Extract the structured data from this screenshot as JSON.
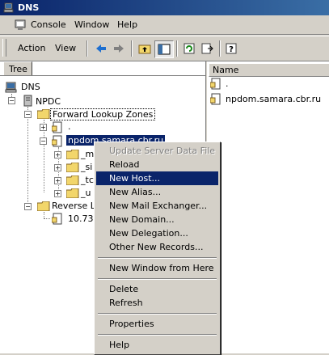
{
  "window": {
    "title": "DNS",
    "icon": "dns-server-icon"
  },
  "menubar": {
    "items": [
      {
        "label": "Console",
        "icon": "console-icon"
      },
      {
        "label": "Window"
      },
      {
        "label": "Help"
      }
    ]
  },
  "toolbar": {
    "action_label": "Action",
    "view_label": "View",
    "buttons": [
      "back-arrow-icon",
      "forward-arrow-icon",
      "up-folder-icon",
      "show-hide-tree-icon",
      "refresh-icon",
      "export-list-icon",
      "help-icon"
    ]
  },
  "left_pane": {
    "tab_label": "Tree",
    "tree": {
      "root": "DNS",
      "server": "NPDC",
      "forward_zones": "Forward Lookup Zones",
      "dot_zone": ".",
      "npdom": "npdom.samara.cbr.ru",
      "sub": [
        "_m",
        "_si",
        "_tc",
        "_u"
      ],
      "reverse_zones": "Reverse Lo",
      "reverse_zone": "10.73."
    }
  },
  "right_pane": {
    "column_name": "Name",
    "rows": [
      ".",
      "npdom.samara.cbr.ru"
    ]
  },
  "context_menu": {
    "items": [
      {
        "label": "Update Server Data File",
        "disabled": true
      },
      {
        "label": "Reload"
      },
      {
        "label": "New Host...",
        "highlighted": true
      },
      {
        "label": "New Alias..."
      },
      {
        "label": "New Mail Exchanger..."
      },
      {
        "label": "New Domain..."
      },
      {
        "label": "New Delegation..."
      },
      {
        "label": "Other New Records..."
      },
      {
        "label": "New Window from Here"
      },
      {
        "label": "Delete"
      },
      {
        "label": "Refresh"
      },
      {
        "label": "Properties"
      },
      {
        "label": "Help"
      }
    ]
  },
  "colors": {
    "selection": "#0a246a",
    "folder": "#f2d66b",
    "face": "#d4d0c8"
  }
}
